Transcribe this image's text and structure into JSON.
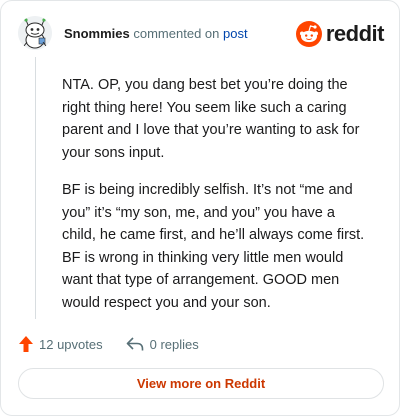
{
  "header": {
    "username": "Snommies",
    "action_text": "commented on",
    "post_link": "post",
    "brand_name": "reddit",
    "avatar_icon": "snoo-avatar-icon",
    "brand_icon": "reddit-logo-icon"
  },
  "comment": {
    "paragraphs": [
      "NTA. OP, you dang best bet you’re doing the right thing here! You seem like such a caring parent and I love that you’re wanting to ask for your sons input.",
      "BF is being incredibly selfish. It’s not “me and you” it’s “my son, me, and you” you have a child, he came first, and he’ll always come first. BF is wrong in thinking very little men would want that type of arrangement. GOOD men would respect you and your son."
    ]
  },
  "actions": {
    "upvotes_label": "12 upvotes",
    "replies_label": "0 replies",
    "upvote_icon": "upvote-arrow-icon",
    "reply_icon": "reply-icon"
  },
  "footer": {
    "view_more_label": "View more on Reddit"
  },
  "colors": {
    "brand_orange": "#ff4500",
    "link_blue": "#0045ac",
    "view_more_text": "#cc3700",
    "muted_text": "#576f76"
  }
}
